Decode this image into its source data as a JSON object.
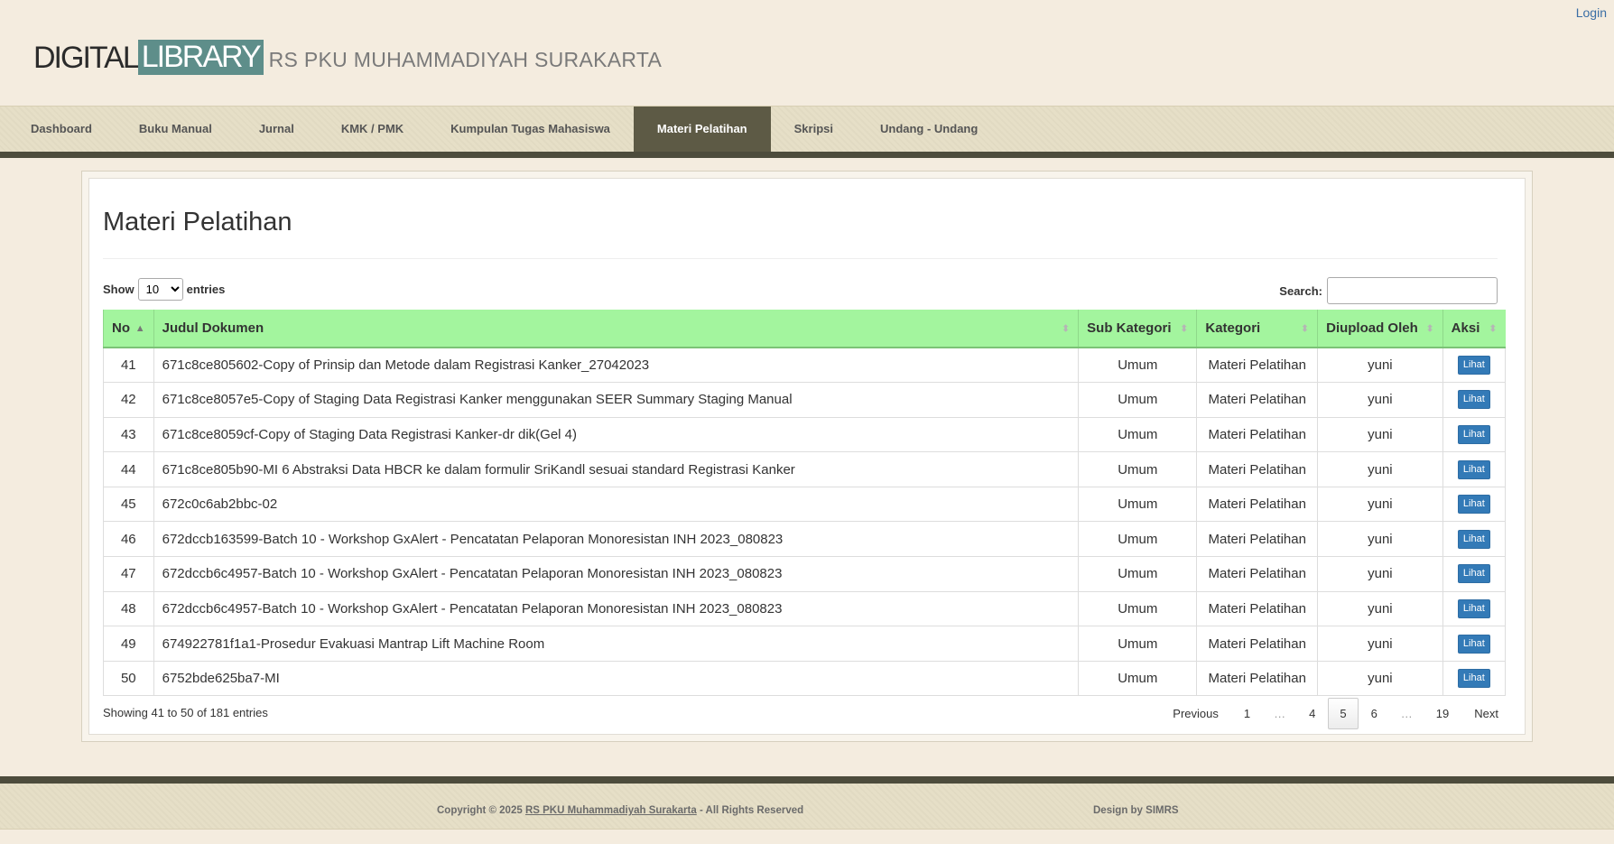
{
  "header": {
    "login": "Login",
    "brand_digital": "DIGITAL",
    "brand_library": "LIBRARY",
    "brand_hospital": "RS PKU MUHAMMADIYAH SURAKARTA"
  },
  "nav": {
    "items": [
      "Dashboard",
      "Buku Manual",
      "Jurnal",
      "KMK / PMK",
      "Kumpulan Tugas Mahasiswa",
      "Materi Pelatihan",
      "Skripsi",
      "Undang - Undang"
    ],
    "active": "Materi Pelatihan"
  },
  "main": {
    "title": "Materi Pelatihan",
    "show_label": "Show",
    "entries_label": "entries",
    "page_size": "10",
    "search_label": "Search:",
    "search_value": "",
    "columns": [
      "No",
      "Judul Dokumen",
      "Sub Kategori",
      "Kategori",
      "Diupload Oleh",
      "Aksi"
    ],
    "rows": [
      {
        "no": "41",
        "judul": "671c8ce805602-Copy of Prinsip dan Metode dalam Registrasi Kanker_27042023",
        "sub": "Umum",
        "kategori": "Materi Pelatihan",
        "oleh": "yuni",
        "aksi": "Lihat"
      },
      {
        "no": "42",
        "judul": "671c8ce8057e5-Copy of Staging Data Registrasi Kanker menggunakan SEER Summary Staging Manual",
        "sub": "Umum",
        "kategori": "Materi Pelatihan",
        "oleh": "yuni",
        "aksi": "Lihat"
      },
      {
        "no": "43",
        "judul": "671c8ce8059cf-Copy of Staging Data Registrasi Kanker-dr dik(Gel 4)",
        "sub": "Umum",
        "kategori": "Materi Pelatihan",
        "oleh": "yuni",
        "aksi": "Lihat"
      },
      {
        "no": "44",
        "judul": "671c8ce805b90-MI 6 Abstraksi Data HBCR ke dalam formulir SriKandl sesuai standard Registrasi Kanker",
        "sub": "Umum",
        "kategori": "Materi Pelatihan",
        "oleh": "yuni",
        "aksi": "Lihat"
      },
      {
        "no": "45",
        "judul": "672c0c6ab2bbc-02",
        "sub": "Umum",
        "kategori": "Materi Pelatihan",
        "oleh": "yuni",
        "aksi": "Lihat"
      },
      {
        "no": "46",
        "judul": "672dccb163599-Batch 10 - Workshop GxAlert - Pencatatan Pelaporan Monoresistan INH 2023_080823",
        "sub": "Umum",
        "kategori": "Materi Pelatihan",
        "oleh": "yuni",
        "aksi": "Lihat"
      },
      {
        "no": "47",
        "judul": "672dccb6c4957-Batch 10 - Workshop GxAlert - Pencatatan Pelaporan Monoresistan INH 2023_080823",
        "sub": "Umum",
        "kategori": "Materi Pelatihan",
        "oleh": "yuni",
        "aksi": "Lihat"
      },
      {
        "no": "48",
        "judul": "672dccb6c4957-Batch 10 - Workshop GxAlert - Pencatatan Pelaporan Monoresistan INH 2023_080823",
        "sub": "Umum",
        "kategori": "Materi Pelatihan",
        "oleh": "yuni",
        "aksi": "Lihat"
      },
      {
        "no": "49",
        "judul": "674922781f1a1-Prosedur Evakuasi Mantrap Lift Machine Room",
        "sub": "Umum",
        "kategori": "Materi Pelatihan",
        "oleh": "yuni",
        "aksi": "Lihat"
      },
      {
        "no": "50",
        "judul": "6752bde625ba7-MI",
        "sub": "Umum",
        "kategori": "Materi Pelatihan",
        "oleh": "yuni",
        "aksi": "Lihat"
      }
    ],
    "info": "Showing 41 to 50 of 181 entries",
    "pager": {
      "previous": "Previous",
      "pages": [
        "1",
        "…",
        "4",
        "5",
        "6",
        "…",
        "19"
      ],
      "current": "5",
      "next": "Next"
    }
  },
  "footer": {
    "copyright_prefix": "Copyright © 2025 ",
    "copyright_link": "RS PKU Muhammadiyah Surakarta",
    "copyright_suffix": " - All Rights Reserved",
    "design": "Design by SIMRS"
  },
  "colors": {
    "header_green": "#a3f59e",
    "nav_active": "#5d5a45",
    "lihat_button": "#337ab7",
    "library_block": "#5e8e8a"
  },
  "icons": {
    "sort_asc": "sort-asc-icon",
    "sort_both": "sort-both-icon"
  }
}
